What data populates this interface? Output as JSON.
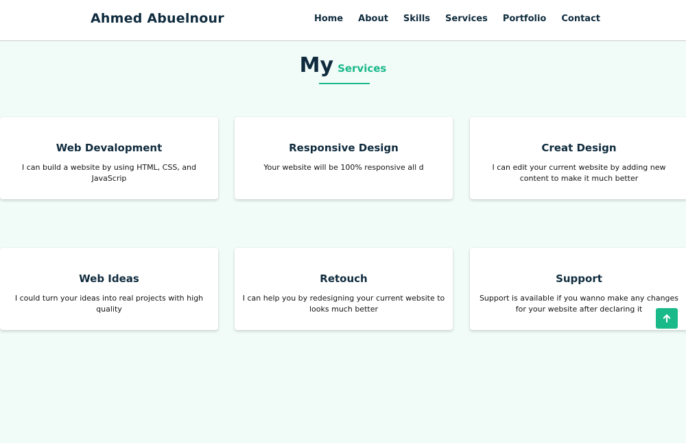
{
  "header": {
    "brand": "Ahmed Abuelnour",
    "nav": [
      "Home",
      "About",
      "Skills",
      "Services",
      "Portfolio",
      "Contact"
    ]
  },
  "section": {
    "title_main": "My",
    "title_accent": "Services"
  },
  "services": [
    {
      "title": "Web Devalopment",
      "text": "I can build a website by using HTML, CSS, and JavaScrip"
    },
    {
      "title": "Responsive Design",
      "text": "Your website will be 100% responsive all d"
    },
    {
      "title": "Creat Design",
      "text": "I can edit your current website by adding new content to make it much better"
    },
    {
      "title": "Web Ideas",
      "text": "I could turn your ideas into real projects with high quality"
    },
    {
      "title": "Retouch",
      "text": "I can help you by redesigning your current website to looks much better"
    },
    {
      "title": "Support",
      "text": "Support is available if you wanno make any changes for your website after declaring it"
    }
  ],
  "colors": {
    "accent": "#1ab98a",
    "text_dark": "#0f2b3d",
    "page_background": "#f1fbf7"
  },
  "icons": {
    "scroll_top": "arrow-up-icon"
  }
}
